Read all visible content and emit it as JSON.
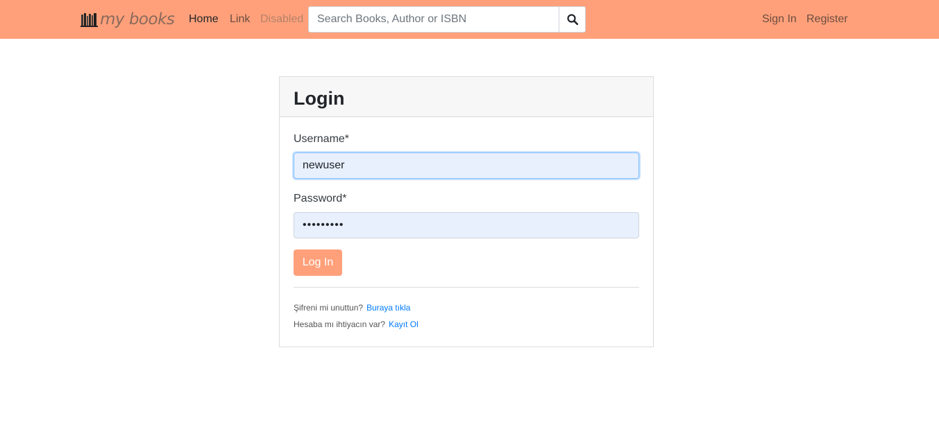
{
  "navbar": {
    "brand": "my books",
    "links": [
      {
        "label": "Home",
        "state": "active"
      },
      {
        "label": "Link",
        "state": "normal"
      },
      {
        "label": "Disabled",
        "state": "disabled"
      }
    ],
    "search": {
      "placeholder": "Search Books, Author or ISBN",
      "value": "",
      "button_icon": "search-icon"
    },
    "right_links": [
      "Sign In",
      "Register"
    ],
    "background_color": "#ffa07a"
  },
  "login_card": {
    "title": "Login",
    "username": {
      "label": "Username*",
      "value": "newuser"
    },
    "password": {
      "label": "Password*",
      "value": "•••••••••"
    },
    "submit_label": "Log In",
    "submit_color": "#ffa07a",
    "forgot": {
      "text": "Şifreni mi unuttun?",
      "link": "Buraya tıkla"
    },
    "register": {
      "text": "Hesaba mı ihtiyacın var?",
      "link": "Kayıt Ol"
    },
    "link_color": "#007bff"
  }
}
